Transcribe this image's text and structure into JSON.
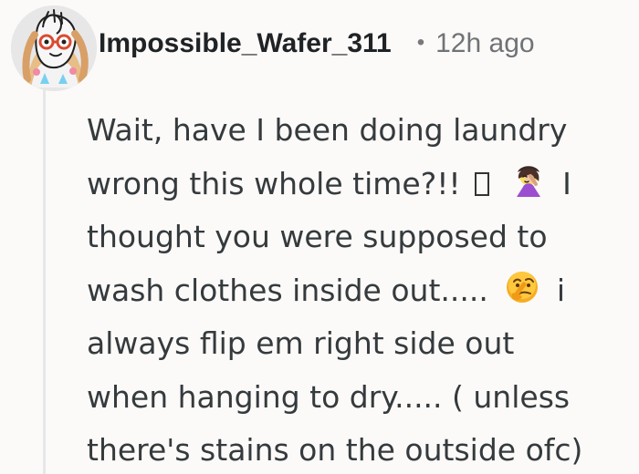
{
  "comment": {
    "username": "Impossible_Wafer_311",
    "separator": "•",
    "timestamp": "12h ago",
    "lines": [
      {
        "before": "Wait, have I been doing laundry",
        "after": ""
      },
      {
        "before": "wrong this whole time?!!",
        "emoji": "woman-facepalming-icon",
        "after": " I"
      },
      {
        "before": "thought you were supposed to",
        "after": ""
      },
      {
        "before": "wash clothes inside out.....",
        "emoji": "thinking-face-icon",
        "after": " i"
      },
      {
        "before": "always flip em right side out",
        "after": ""
      },
      {
        "before": "when hanging to dry..... ( unless",
        "after": ""
      },
      {
        "before": "there's stains on the outside ofc)",
        "after": ""
      }
    ]
  },
  "colors": {
    "background": "#fbfaf8",
    "username": "#202326",
    "timestamp": "#707376",
    "body_text": "#353a3d"
  }
}
